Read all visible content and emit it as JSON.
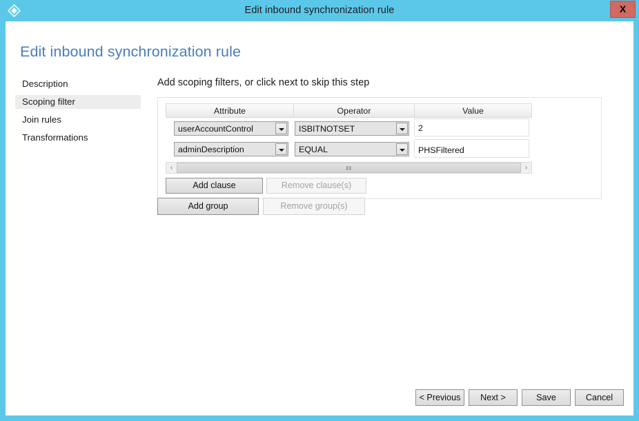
{
  "window": {
    "title": "Edit inbound synchronization rule",
    "icon": "azure-diamond-icon",
    "close_label": "X",
    "border_color": "#5bc8ea",
    "close_color": "#d06a63"
  },
  "page": {
    "heading": "Edit inbound synchronization rule",
    "heading_color": "#4a7ebb"
  },
  "sidebar": {
    "items": [
      {
        "label": "Description",
        "selected": false
      },
      {
        "label": "Scoping filter",
        "selected": true
      },
      {
        "label": "Join rules",
        "selected": false
      },
      {
        "label": "Transformations",
        "selected": false
      }
    ],
    "selected_bg": "#ededed"
  },
  "main": {
    "instruction": "Add scoping filters, or click next to skip this step",
    "table": {
      "headers": [
        "Attribute",
        "Operator",
        "Value"
      ],
      "rows": [
        {
          "attribute": "userAccountControl",
          "operator": "ISBITNOTSET",
          "value": "2"
        },
        {
          "attribute": "adminDescription",
          "operator": "EQUAL",
          "value": "PHSFiltered"
        }
      ]
    },
    "scrollbar": {
      "left_arrow": "‹",
      "right_arrow": "›",
      "grip": "‖‖"
    },
    "clause_buttons": {
      "add": "Add clause",
      "remove": "Remove clause(s)",
      "remove_enabled": false
    },
    "group_buttons": {
      "add": "Add group",
      "remove": "Remove group(s)",
      "remove_enabled": false
    }
  },
  "footer": {
    "previous": "< Previous",
    "next": "Next >",
    "save": "Save",
    "cancel": "Cancel"
  }
}
